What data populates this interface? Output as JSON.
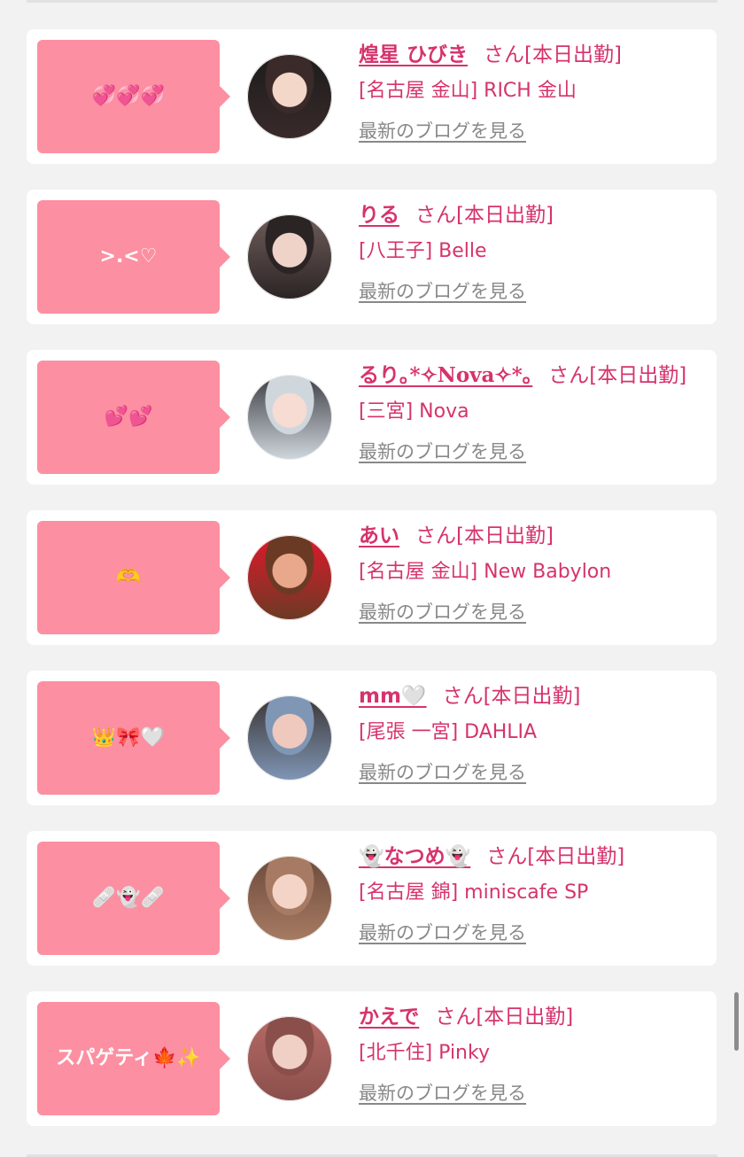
{
  "cards": [
    {
      "bubble": "💞💞💞",
      "name": "煌星 ひびき",
      "suffix": "さん[本日出勤]",
      "shop": "[名古屋 金山] RICH 金山",
      "blog": "最新のブログを見る",
      "avatar_colors": [
        "#3a2a2a",
        "#f3d7c8",
        "#1c1c1c"
      ]
    },
    {
      "bubble": ">.<♡",
      "name": "りる",
      "suffix": "さん[本日出勤]",
      "shop": "[八王子] Belle",
      "blog": "最新のブログを見る",
      "avatar_colors": [
        "#2b2424",
        "#f0d3c8",
        "#6e5d5a"
      ]
    },
    {
      "bubble": "💕💕",
      "name": "るり｡*✧Nova✧*｡",
      "suffix": "さん[本日出勤]",
      "shop": "[三宮] Nova",
      "blog": "最新のブログを見る",
      "avatar_colors": [
        "#cfd7dd",
        "#f6dcd3",
        "#3d3d44"
      ]
    },
    {
      "bubble": "🫶",
      "name": "あい",
      "suffix": "さん[本日出勤]",
      "shop": "[名古屋 金山] New Babylon",
      "blog": "最新のブログを見る",
      "avatar_colors": [
        "#6b3a24",
        "#e9a88b",
        "#e0182b"
      ]
    },
    {
      "bubble": "👑🎀🤍",
      "name": "mm🤍",
      "suffix": "さん[本日出勤]",
      "shop": "[尾張 一宮] DAHLIA",
      "blog": "最新のブログを見る",
      "avatar_colors": [
        "#7f96b5",
        "#efc9bd",
        "#3b3433"
      ]
    },
    {
      "bubble": "🩹👻🩹",
      "name": "👻なつめ👻",
      "suffix": "さん[本日出勤]",
      "shop": "[名古屋 錦] miniscafe SP",
      "blog": "最新のブログを見る",
      "avatar_colors": [
        "#a77b63",
        "#f4d4c6",
        "#6c4a3c"
      ]
    },
    {
      "bubble": "スパゲティ🍁✨",
      "name": "かえで",
      "suffix": "さん[本日出勤]",
      "shop": "[北千住] Pinky",
      "blog": "最新のブログを見る",
      "avatar_colors": [
        "#8a4f4b",
        "#f0cfc4",
        "#b56a66"
      ]
    }
  ]
}
